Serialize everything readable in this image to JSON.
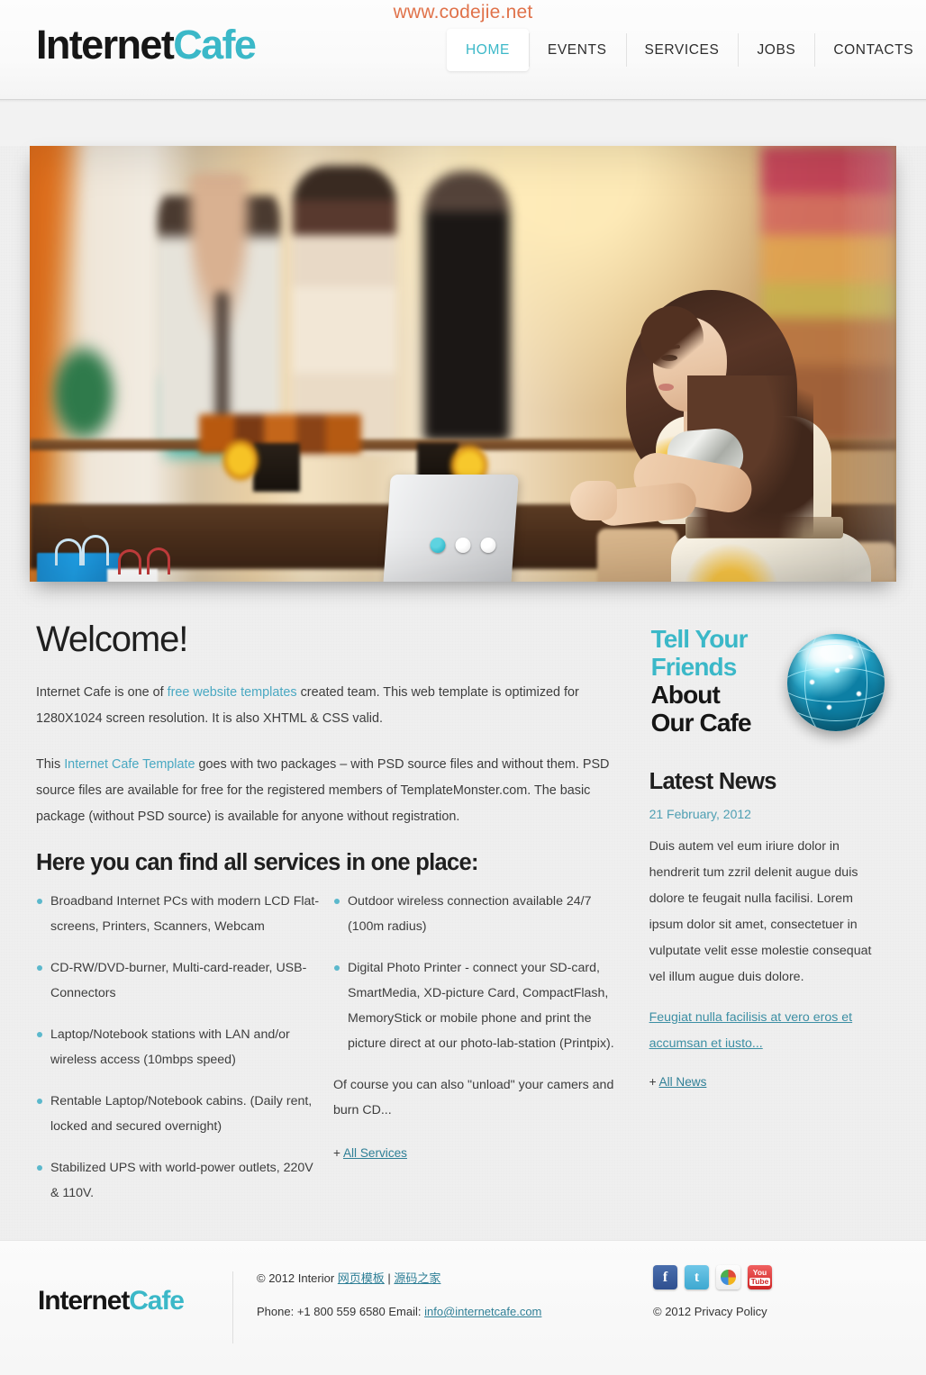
{
  "watermark": "www.codejie.net",
  "header": {
    "logo": {
      "part1": "Internet",
      "part2": "Cafe"
    },
    "nav": [
      {
        "label": "HOME",
        "active": true
      },
      {
        "label": "EVENTS",
        "active": false
      },
      {
        "label": "SERVICES",
        "active": false
      },
      {
        "label": "JOBS",
        "active": false
      },
      {
        "label": "CONTACTS",
        "active": false
      }
    ]
  },
  "slider": {
    "dots": [
      {
        "name": "slide-1",
        "active": true
      },
      {
        "name": "slide-2",
        "active": false
      },
      {
        "name": "slide-3",
        "active": false
      }
    ],
    "image_alt": "Woman using a laptop at a cafe table in a shopping mall"
  },
  "main": {
    "welcome_title": "Welcome!",
    "paragraph1_a": "Internet Cafe is one of ",
    "paragraph1_link": "free website templates",
    "paragraph1_b": " created team. This web template is optimized for 1280X1024 screen resolution. It is also XHTML & CSS valid.",
    "paragraph2_a": "This ",
    "paragraph2_link": "Internet Cafe Template",
    "paragraph2_b": " goes with two packages – with PSD source files and without them. PSD source files are available for free for the registered members of TemplateMonster.com. The basic package (without PSD source) is available for anyone without registration.",
    "services_title": "Here you can find all services in one place:",
    "services_left": [
      "Broadband Internet PCs with modern LCD Flat-screens, Printers, Scanners, Webcam",
      "CD-RW/DVD-burner, Multi-card-reader, USB-Connectors",
      "Laptop/Notebook stations with LAN and/or wireless access (10mbps speed)",
      "Rentable Laptop/Notebook cabins. (Daily rent, locked and secured overnight)",
      "Stabilized UPS with world-power outlets, 220V & 110V."
    ],
    "services_right": [
      "Outdoor wireless connection available 24/7 (100m radius)",
      "Digital Photo Printer - connect your SD-card, SmartMedia, XD-picture Card, CompactFlash, MemoryStick or mobile phone and print the picture direct at our photo-lab-station (Printpix)."
    ],
    "services_right_extra": "Of course you can also \"unload\" your camers and burn CD...",
    "all_services_prefix": "+ ",
    "all_services_label": "All Services"
  },
  "sidebar": {
    "tell_line1": "Tell Your",
    "tell_line2": "Friends",
    "tell_line3": "About",
    "tell_line4": "Our Cafe",
    "news_title": "Latest News",
    "news_date": "21 February, 2012",
    "news_body": "Duis autem vel eum iriure dolor in hendrerit tum zzril delenit augue duis dolore te feugait nulla facilisi. Lorem ipsum dolor sit amet, consectetuer in vulputate velit esse molestie consequat vel illum augue duis dolore.",
    "news_link": "Feugiat nulla facilisis at vero eros et accumsan et iusto...",
    "all_news_prefix": "+ ",
    "all_news_label": "All News"
  },
  "footer": {
    "logo": {
      "part1": "Internet",
      "part2": "Cafe"
    },
    "copyright_prefix": "© 2012 Interior ",
    "copyright_link1": "网页模板",
    "copyright_sep": " | ",
    "copyright_link2": "源码之家",
    "phone_label": "Phone: +1 800 559 6580 Email: ",
    "email": "info@internetcafe.com",
    "privacy": "© 2012 Privacy Policy",
    "social": [
      {
        "name": "facebook-icon",
        "glyph": "f"
      },
      {
        "name": "twitter-icon",
        "glyph": "t"
      },
      {
        "name": "google-icon",
        "glyph": ""
      },
      {
        "name": "youtube-icon",
        "glyph_top": "You",
        "glyph_bottom": "Tube"
      }
    ]
  },
  "colors": {
    "accent_teal": "#3bb8c8",
    "link": "#2f7f96",
    "watermark": "#e0724a",
    "text": "#3d3d3d"
  }
}
